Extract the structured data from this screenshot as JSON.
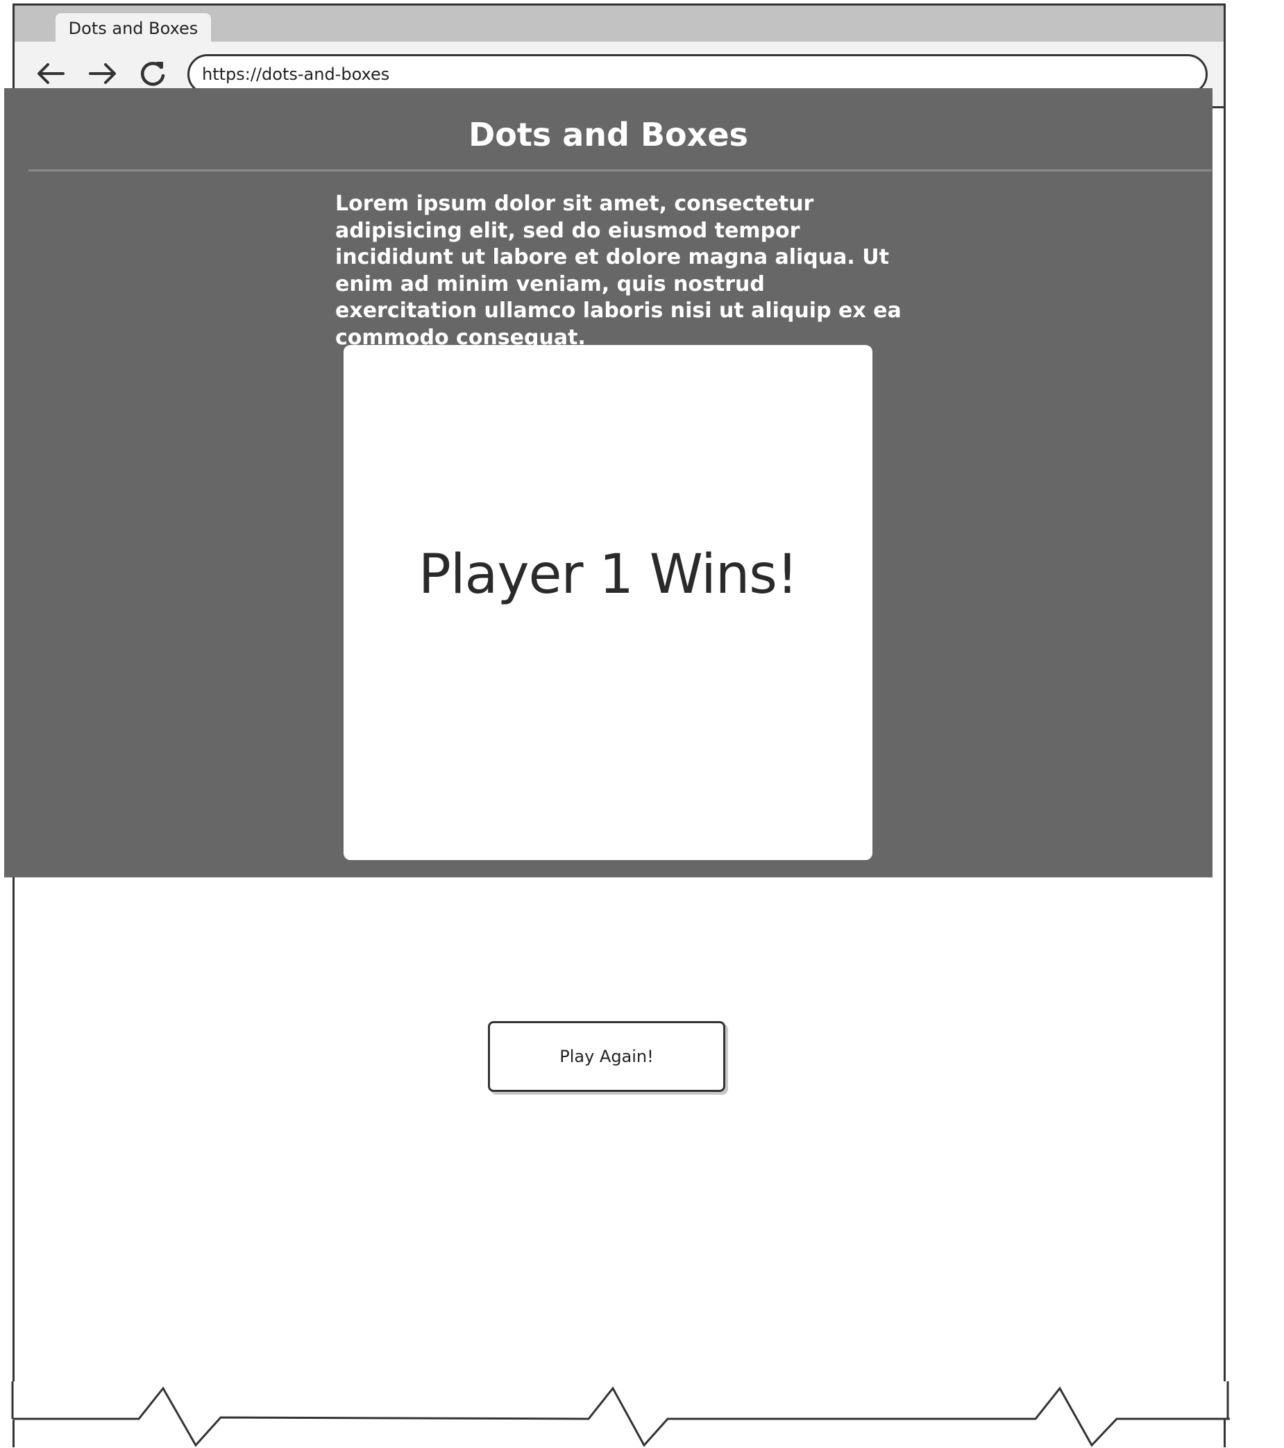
{
  "browser": {
    "tab_title": "Dots and Boxes",
    "url": "https://dots-and-boxes"
  },
  "page": {
    "title": "Dots and Boxes",
    "intro": "Lorem ipsum dolor sit amet, consectetur adipisicing elit, sed do eiusmod tempor incididunt ut labore et dolore magna aliqua. Ut enim ad minim veniam, quis nostrud exercitation ullamco laboris nisi ut aliquip ex ea commodo consequat."
  },
  "modal": {
    "message": "Player 1 Wins!"
  },
  "actions": {
    "play_again_label": "Play Again!"
  },
  "colors": {
    "overlay": "#676767",
    "tabbar": "#c2c2c2",
    "chrome": "#f2f2f2"
  }
}
